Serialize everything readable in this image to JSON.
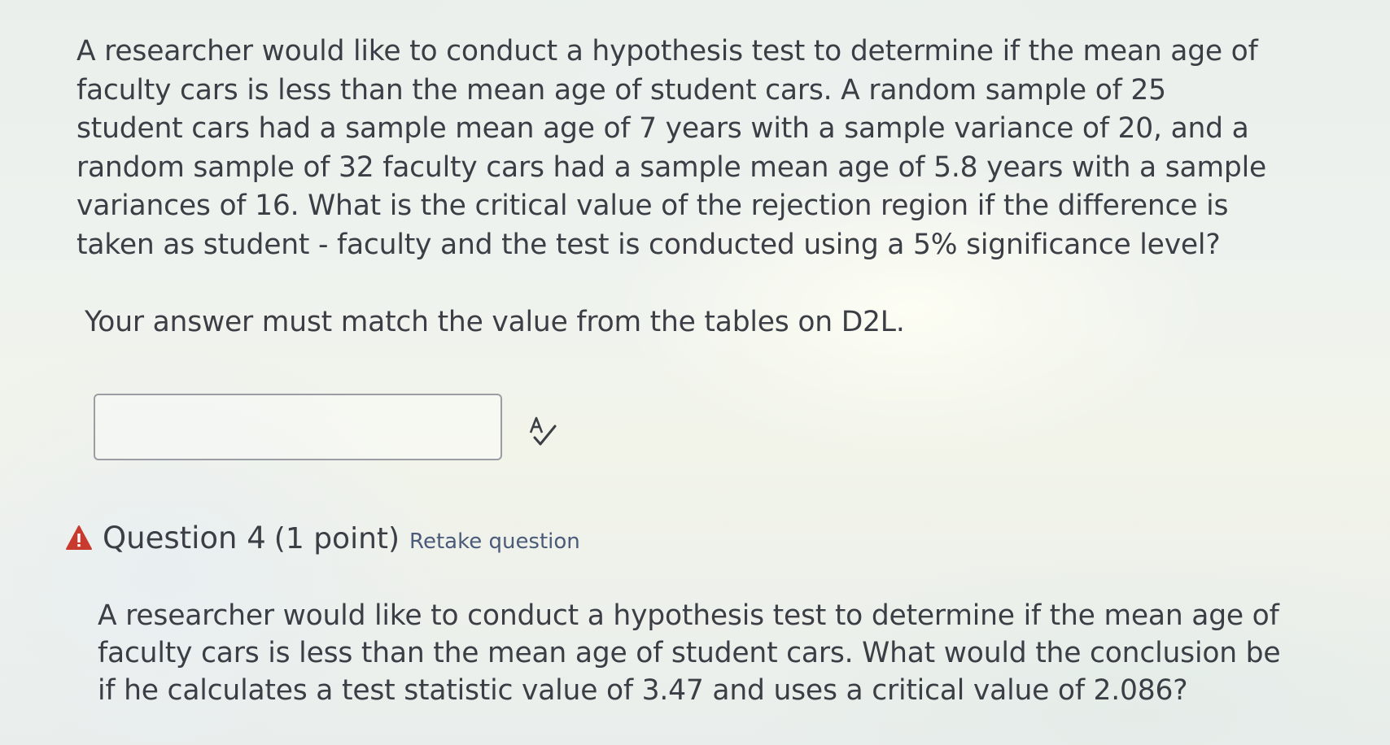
{
  "question3": {
    "lines": [
      "A researcher would like to conduct a hypothesis test to determine if the mean age of",
      "faculty cars is less than the mean age of student cars.  A random sample of 25",
      "student cars had a sample mean age of 7 years with a sample variance of 20, and a",
      "random sample of 32 faculty cars had a sample mean age of 5.8 years with a sample",
      "variances of 16.  What is the critical value of the rejection region if the difference is",
      "taken as student - faculty and the test is conducted using a 5% significance level?"
    ],
    "instruction": "Your answer must match the value from the tables on D2L.",
    "answer_value": "",
    "answer_placeholder": ""
  },
  "question4": {
    "title": "Question 4",
    "points": "(1 point)",
    "retake_label": "Retake question",
    "lines": [
      "A researcher would like to conduct a hypothesis test to determine if the mean age of",
      "faculty cars is less than the mean age of student cars.  What would the conclusion be",
      "if he calculates a test statistic value of 3.47 and uses a critical value of 2.086?"
    ]
  },
  "icons": {
    "spellcheck": "spellcheck-icon",
    "warning": "warning-icon"
  },
  "colors": {
    "text": "#3b3e45",
    "warning": "#c93a2e",
    "link": "#4a5a78",
    "input_border": "#9a9ea4"
  }
}
